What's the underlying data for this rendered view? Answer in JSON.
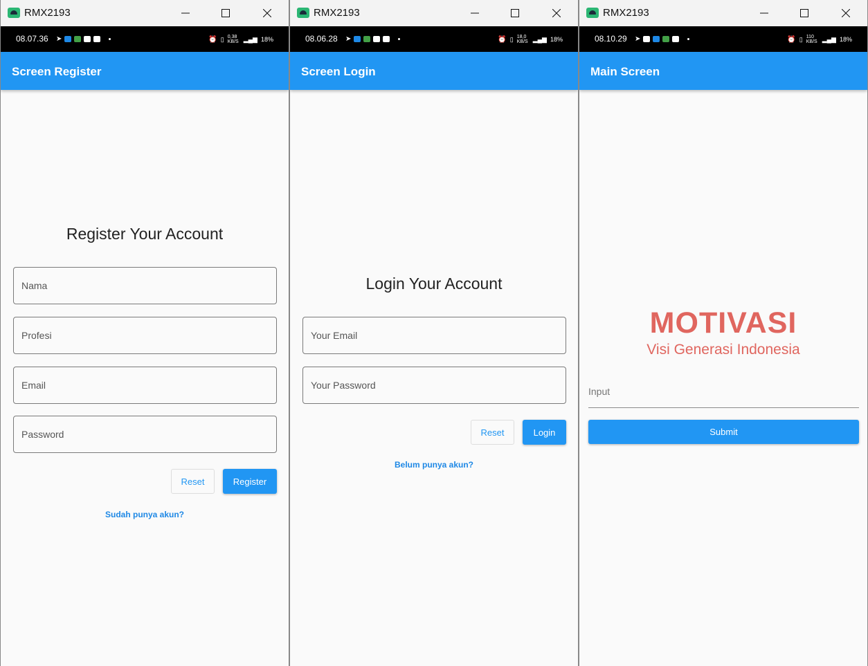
{
  "windows": [
    {
      "title": "RMX2193",
      "status": {
        "time": "08.07.36",
        "speed": "0,38 KB/S",
        "battery": "18%"
      },
      "appbar_title": "Screen Register",
      "heading": "Register Your Account",
      "fields": [
        "Nama",
        "Profesi",
        "Email",
        "Password"
      ],
      "reset_label": "Reset",
      "primary_label": "Register",
      "link": "Sudah punya akun?"
    },
    {
      "title": "RMX2193",
      "status": {
        "time": "08.06.28",
        "speed": "18,0 KB/S",
        "battery": "18%"
      },
      "appbar_title": "Screen Login",
      "heading": "Login Your Account",
      "fields": [
        "Your Email",
        "Your Password"
      ],
      "reset_label": "Reset",
      "primary_label": "Login",
      "link": "Belum punya akun?"
    },
    {
      "title": "RMX2193",
      "status": {
        "time": "08.10.29",
        "speed": "110 KB/S",
        "battery": "18%"
      },
      "appbar_title": "Main Screen",
      "brand_title": "MOTIVASI",
      "brand_subtitle": "Visi Generasi Indonesia",
      "input_placeholder": "Input",
      "submit_label": "Submit"
    }
  ],
  "colors": {
    "primary": "#2196f3",
    "brand_red": "#e0665f",
    "status_bar": "#000000"
  }
}
